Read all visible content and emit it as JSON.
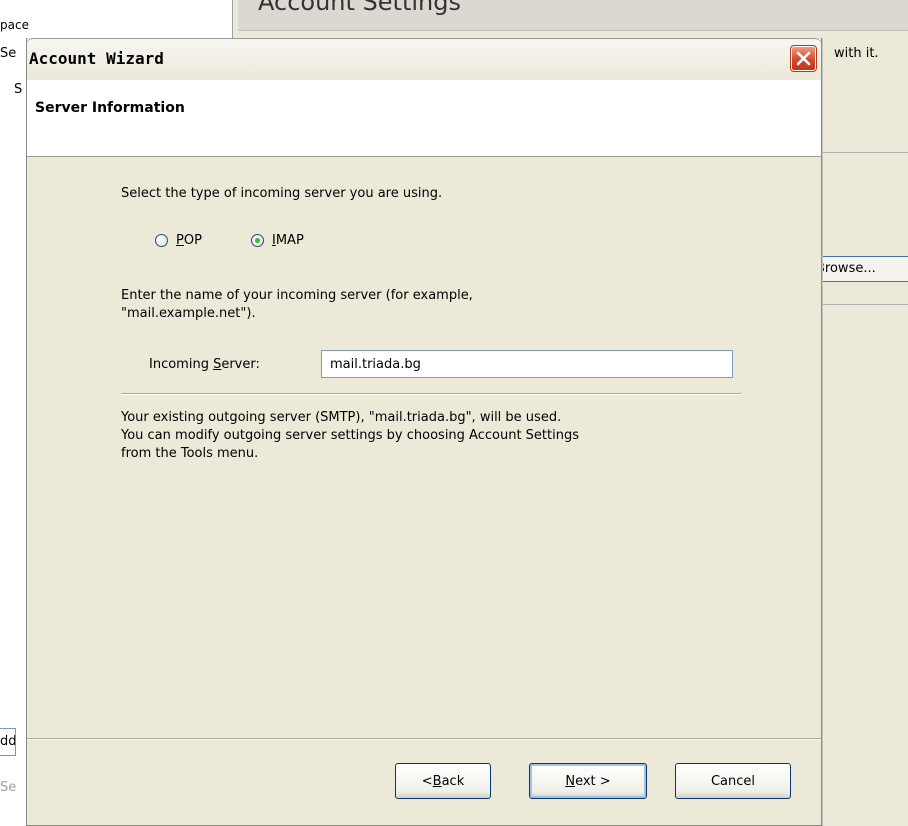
{
  "background": {
    "left_panel_lines": [
      "pace",
      "Se",
      "S"
    ],
    "heading": "Account Settings",
    "right_text": "with it.",
    "browse_button": "Browse...",
    "left_button": "dd",
    "left_gray": "Se"
  },
  "dialog": {
    "title": "Account Wizard",
    "close_icon": "close-icon",
    "header": "Server Information",
    "server_type_prompt": "Select the type of incoming server you are using.",
    "server_types": [
      {
        "label": "POP",
        "accesskey": "P",
        "rest": "OP",
        "selected": false
      },
      {
        "label": "IMAP",
        "accesskey": "I",
        "rest": "MAP",
        "selected": true
      }
    ],
    "server_name_prompt_line1": "Enter the name of your incoming server (for example,",
    "server_name_prompt_line2": "\"mail.example.net\").",
    "incoming_server_label_pre": "Incoming ",
    "incoming_server_label_key": "S",
    "incoming_server_label_post": "erver:",
    "incoming_server_value": "mail.triada.bg",
    "info_line1": "Your existing outgoing server (SMTP), \"mail.triada.bg\", will be used.",
    "info_line2": "You can modify outgoing server settings by choosing Account Settings",
    "info_line3": "from the Tools menu.",
    "buttons": {
      "back_pre": "< ",
      "back_key": "B",
      "back_post": "ack",
      "next_key": "N",
      "next_post": "ext >",
      "cancel": "Cancel"
    }
  },
  "colors": {
    "dialog_bg": "#ece9d8",
    "close_button": "#d8482a",
    "radio_selected": "#21a121"
  }
}
